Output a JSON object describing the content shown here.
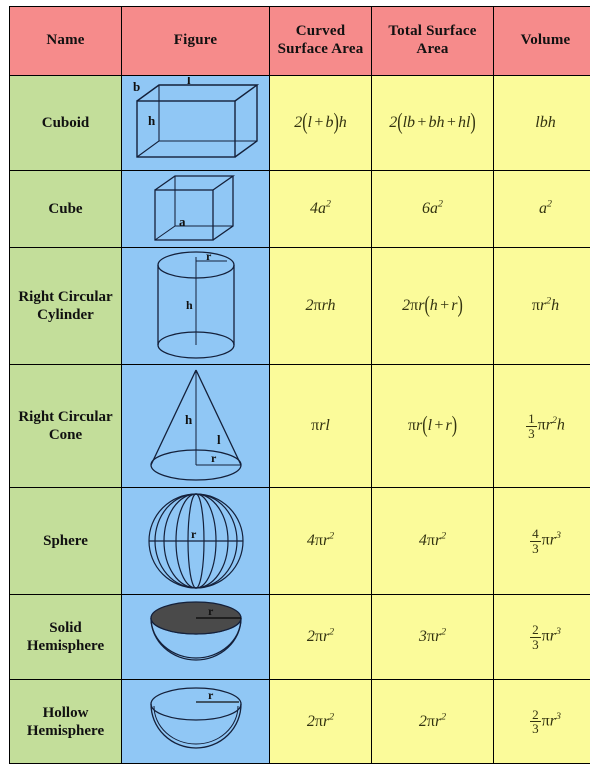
{
  "table": {
    "headers": [
      {
        "key": "name",
        "label": "Name"
      },
      {
        "key": "figure",
        "label": "Figure"
      },
      {
        "key": "csa",
        "label": "Curved Surface Area"
      },
      {
        "key": "tsa",
        "label": "Total Surface Area"
      },
      {
        "key": "vol",
        "label": "Volume"
      }
    ],
    "colors": {
      "header_bg": "#F68B8B",
      "name_bg": "#C3DE9A",
      "figure_bg": "#90C7F5",
      "formula_bg": "#FBFB9A",
      "border": "#000000",
      "solid_fill": "#4A4A4A"
    },
    "rows": [
      {
        "name": "Cuboid",
        "figure": "cuboid-figure",
        "figure_labels": [
          "b",
          "l",
          "h"
        ],
        "csa": "2(l+b)h",
        "tsa": "2(lb+bh+hl)",
        "vol": "lbh"
      },
      {
        "name": "Cube",
        "figure": "cube-figure",
        "figure_labels": [
          "a"
        ],
        "csa": "4a2",
        "tsa": "6a2",
        "vol": "a2"
      },
      {
        "name": "Right Circular Cylinder",
        "figure": "cylinder-figure",
        "figure_labels": [
          "r",
          "h"
        ],
        "csa": "2πrh",
        "tsa": "2πr(h+r)",
        "vol": "πr2h"
      },
      {
        "name": "Right Circular Cone",
        "figure": "cone-figure",
        "figure_labels": [
          "h",
          "l",
          "r"
        ],
        "csa": "πrl",
        "tsa": "πr(l+r)",
        "vol": "1/3 πr2h"
      },
      {
        "name": "Sphere",
        "figure": "sphere-figure",
        "figure_labels": [
          "r"
        ],
        "csa": "4πr2",
        "tsa": "4πr2",
        "vol": "4/3 πr3"
      },
      {
        "name": "Solid Hemisphere",
        "figure": "solid-hemisphere-figure",
        "figure_labels": [
          "r"
        ],
        "csa": "2πr2",
        "tsa": "3πr2",
        "vol": "2/3 πr3"
      },
      {
        "name": "Hollow Hemisphere",
        "figure": "hollow-hemisphere-figure",
        "figure_labels": [
          "r"
        ],
        "csa": "2πr2",
        "tsa": "2πr2",
        "vol": "2/3 πr3"
      }
    ],
    "labels": {
      "l": "l",
      "b": "b",
      "h": "h",
      "a": "a",
      "r": "r",
      "pi": "π",
      "two": "2",
      "three": "3",
      "four": "4",
      "six": "6",
      "one": "1",
      "exp2": "2",
      "exp3": "3",
      "plus": "+",
      "lparen": "(",
      "rparen": ")"
    }
  }
}
